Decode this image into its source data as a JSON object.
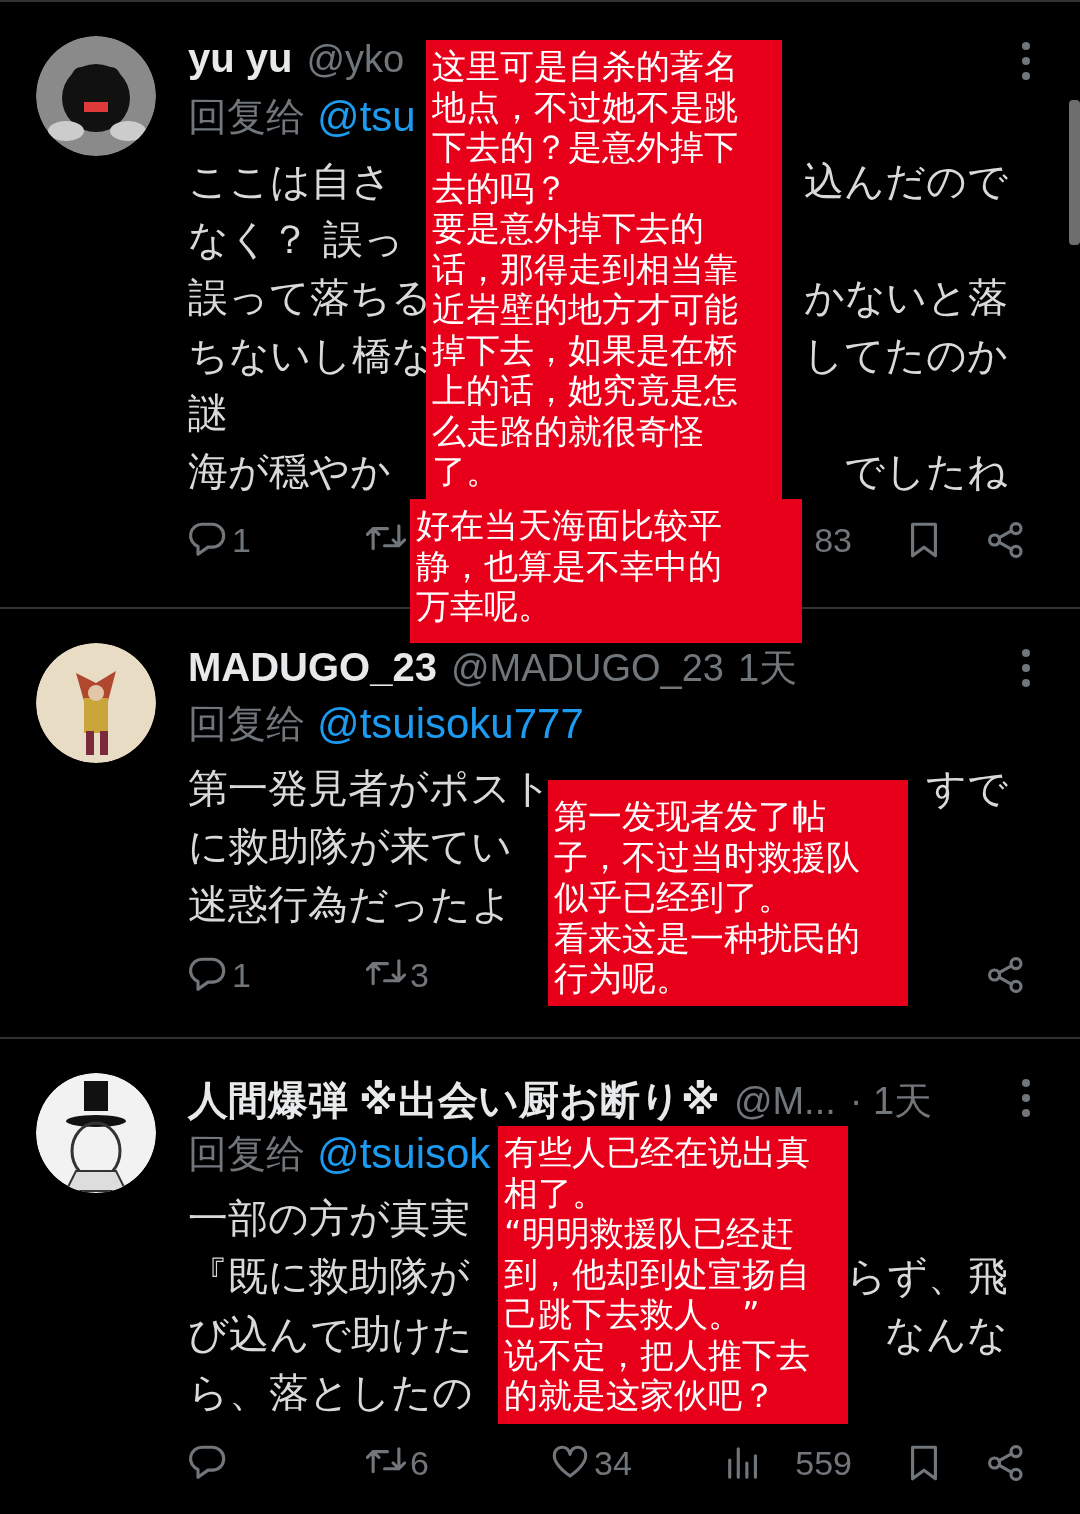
{
  "tweets": [
    {
      "name": "yu yu",
      "handle": "@yko",
      "reply_label": "回复给",
      "reply_to": "@tsu",
      "body": [
        {
          "left": "ここは自さ",
          "right": "込んだので"
        },
        {
          "left": "なく？ 誤っ"
        },
        {
          "left": "誤って落ちる",
          "right": "かないと落"
        },
        {
          "left": "ちないし橋な",
          "right": "してたのか"
        },
        {
          "left": "謎"
        },
        {
          "left": "海が穏やか",
          "right": "でしたね"
        }
      ],
      "actions": [
        {
          "kind": "reply",
          "count": "1"
        },
        {
          "kind": "repost"
        },
        {
          "kind": "views_count",
          "count": "83"
        },
        {
          "kind": "bookmark"
        },
        {
          "kind": "share"
        }
      ]
    },
    {
      "name": "MADUGO_23",
      "handle": "@MADUGO_23",
      "time": "1天",
      "reply_label": "回复给",
      "reply_to": "@tsuisoku777",
      "body": [
        {
          "left": "第一発見者がポスト",
          "right": "すで"
        },
        {
          "left": "に救助隊が来てい"
        },
        {
          "left": "迷惑行為だったよ"
        }
      ],
      "actions": [
        {
          "kind": "reply",
          "count": "1"
        },
        {
          "kind": "repost",
          "count": "3"
        },
        {
          "kind": "share"
        }
      ]
    },
    {
      "name": "人間爆弾 ※出会い厨お断り※",
      "handle": "@M...",
      "time": "· 1天",
      "reply_label": "回复给",
      "reply_to": "@tsuisok",
      "body": [
        {
          "left": "一部の方が真実"
        },
        {
          "left": "『既に救助隊が",
          "right": "らず、飛"
        },
        {
          "left": "び込んで助けた",
          "right": "なんな"
        },
        {
          "left": "ら、落としたの"
        }
      ],
      "actions": [
        {
          "kind": "reply"
        },
        {
          "kind": "repost",
          "count": "6"
        },
        {
          "kind": "like",
          "count": "34"
        },
        {
          "kind": "views",
          "count": "559"
        },
        {
          "kind": "bookmark"
        },
        {
          "kind": "share"
        }
      ]
    }
  ],
  "notes": [
    {
      "lines": [
        "这里可是自杀的著名",
        "地点，不过她不是跳",
        "下去的？是意外掉下",
        "去的吗？",
        "要是意外掉下去的",
        "话，那得走到相当靠",
        "近岩壁的地方才可能",
        "掉下去，如果是在桥",
        "上的话，她究竟是怎",
        "么走路的就很奇怪",
        "了。"
      ]
    },
    {
      "lines": [
        "好在当天海面比较平",
        "静，也算是不幸中的",
        "万幸呢。"
      ]
    },
    {
      "lines": [
        "第一发现者发了帖",
        "子，不过当时救援队",
        "似乎已经到了。",
        "看来这是一种扰民的",
        "行为呢。"
      ]
    },
    {
      "lines": [
        "有些人已经在说出真",
        "相了。",
        "“明明救援队已经赶",
        "到，他却到处宣扬自",
        "己跳下去救人。”",
        "说不定，把人推下去",
        "的就是这家伙吧？"
      ]
    }
  ]
}
